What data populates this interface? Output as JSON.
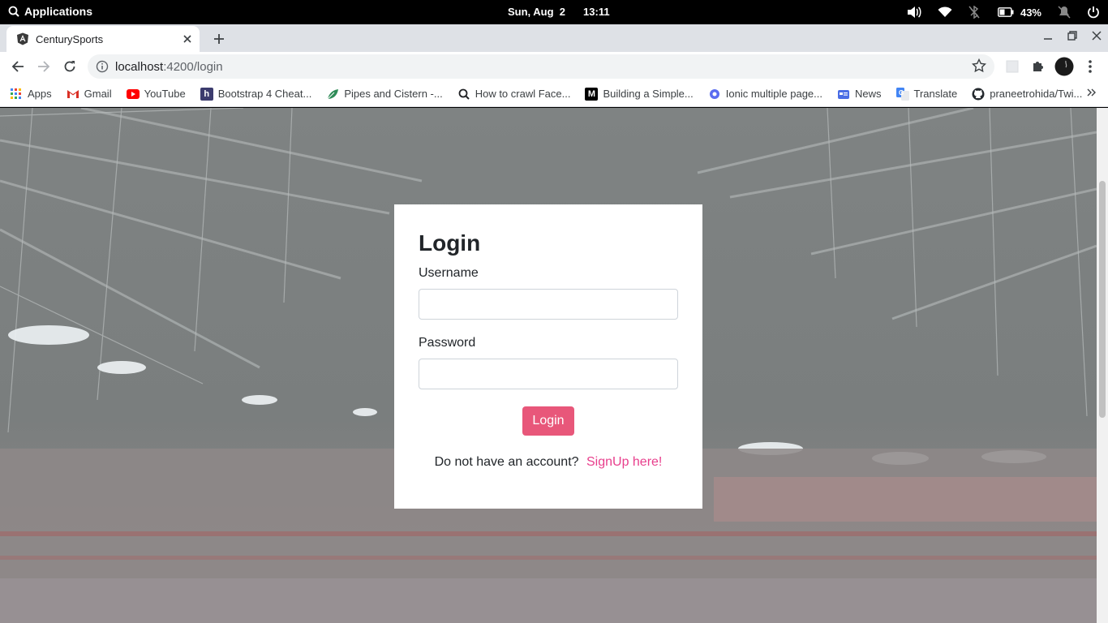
{
  "topbar": {
    "apps_label": "Applications",
    "date": "Sun, Aug  2",
    "time": "13:11",
    "battery": "43%",
    "icons": [
      "search-icon",
      "volume-icon",
      "wifi-icon",
      "bluetooth-off-icon",
      "battery-icon",
      "notifications-off-icon",
      "power-icon"
    ]
  },
  "browser": {
    "tab_title": "CenturySports",
    "url_host": "localhost",
    "url_path": ":4200/login"
  },
  "bookmarks": [
    {
      "label": "Apps",
      "icon": "apps-grid-icon",
      "color": "#4285f4"
    },
    {
      "label": "Gmail",
      "icon": "gmail-icon",
      "color": "#d93025"
    },
    {
      "label": "YouTube",
      "icon": "youtube-icon",
      "color": "#ff0000"
    },
    {
      "label": "Bootstrap 4 Cheat...",
      "icon": "hackerrank-icon",
      "color": "#3c3c6e"
    },
    {
      "label": "Pipes and Cistern -...",
      "icon": "leaf-icon",
      "color": "#2e8b57"
    },
    {
      "label": "How to crawl Face...",
      "icon": "search-icon",
      "color": "#202124"
    },
    {
      "label": "Building a Simple...",
      "icon": "medium-icon",
      "color": "#000000"
    },
    {
      "label": "Ionic multiple page...",
      "icon": "ionic-icon",
      "color": "#5a6cf0"
    },
    {
      "label": "News",
      "icon": "news-icon",
      "color": "#4a6de5"
    },
    {
      "label": "Translate",
      "icon": "translate-icon",
      "color": "#4285f4"
    },
    {
      "label": "praneetrohida/Twi...",
      "icon": "github-icon",
      "color": "#24292e"
    }
  ],
  "login": {
    "heading": "Login",
    "username_label": "Username",
    "username_value": "",
    "password_label": "Password",
    "password_value": "",
    "button_label": "Login",
    "signup_prompt": "Do not have an account?",
    "signup_link": "SignUp here!"
  },
  "colors": {
    "accent": "#e8577a",
    "link": "#e83e8c"
  }
}
